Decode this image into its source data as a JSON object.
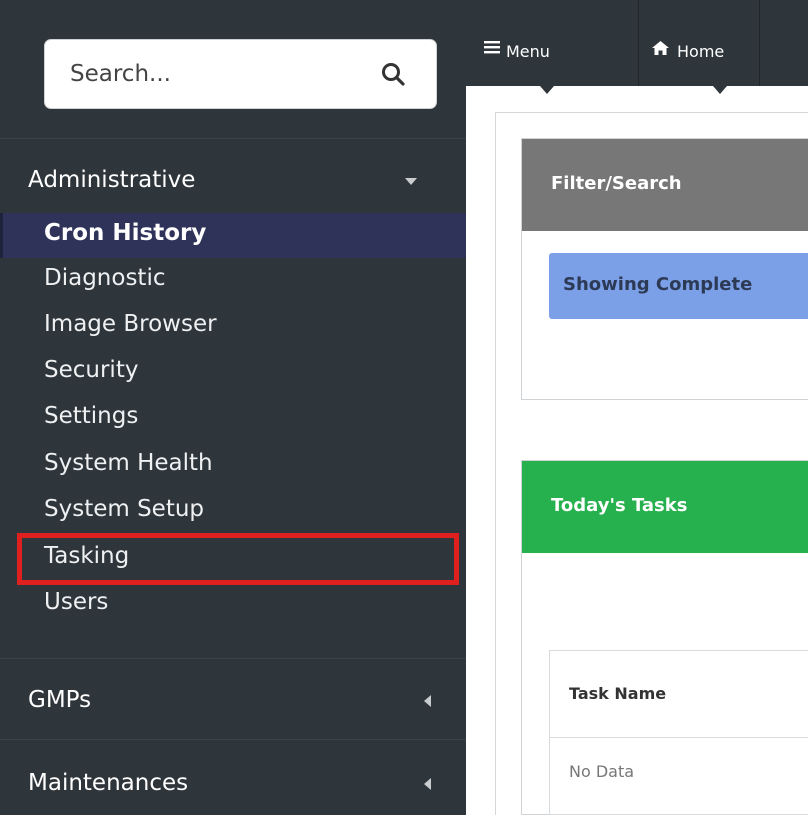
{
  "search": {
    "placeholder": "Search..."
  },
  "sidebar": {
    "groups": [
      {
        "label": "Administrative",
        "expanded": true,
        "items": [
          {
            "label": "Cron History",
            "active": true
          },
          {
            "label": "Diagnostic"
          },
          {
            "label": "Image Browser"
          },
          {
            "label": "Security"
          },
          {
            "label": "Settings"
          },
          {
            "label": "System Health"
          },
          {
            "label": "System Setup"
          },
          {
            "label": "Tasking",
            "highlighted": true
          },
          {
            "label": "Users"
          }
        ]
      },
      {
        "label": "GMPs",
        "expanded": false
      },
      {
        "label": "Maintenances",
        "expanded": false
      }
    ]
  },
  "topnav": {
    "menu": {
      "icon": "hamburger-icon",
      "label": "Menu"
    },
    "home": {
      "icon": "home-icon",
      "label": "Home"
    }
  },
  "main": {
    "filter_panel": {
      "title": "Filter/Search",
      "status_text": "Showing Complete"
    },
    "tasks_panel": {
      "title": "Today's Tasks",
      "table": {
        "columns": [
          "Task Name"
        ],
        "empty_text": "No Data"
      }
    }
  },
  "colors": {
    "sidebar_bg": "#2e353b",
    "active_item_bg": "#2f3359",
    "highlight_border": "#e0201f",
    "filter_header": "#777777",
    "tasks_header": "#27b04e",
    "status_bar": "#7ba0e7"
  }
}
